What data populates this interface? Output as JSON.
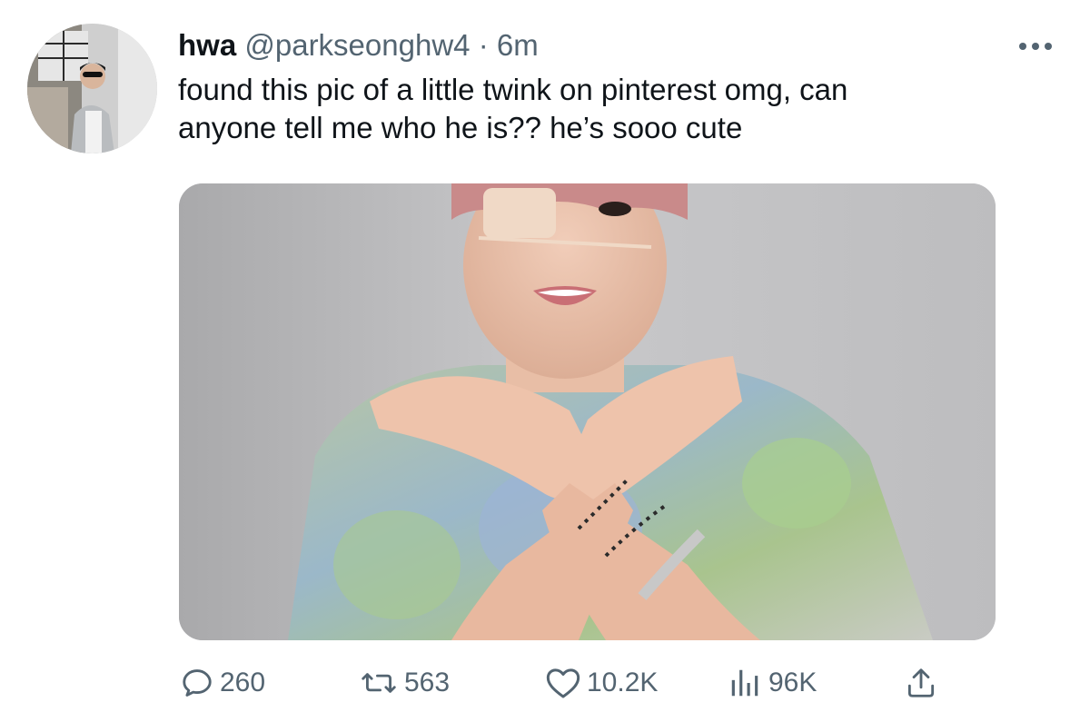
{
  "tweet": {
    "display_name": "hwa",
    "handle": "@parkseonghw4",
    "separator": "·",
    "timestamp": "6m",
    "text_line1": "found this pic of a little twink on pinterest omg, can",
    "text_line2": "anyone tell me who he is?? he’s sooo cute"
  },
  "actions": {
    "replies": "260",
    "retweets": "563",
    "likes": "10.2K",
    "views": "96K"
  },
  "icons": {
    "more": "more-horizontal-icon",
    "reply": "reply-icon",
    "retweet": "retweet-icon",
    "like": "heart-icon",
    "views": "views-icon",
    "share": "share-icon"
  },
  "colors": {
    "text": "#0f1419",
    "secondary": "#536471",
    "background": "#ffffff"
  }
}
